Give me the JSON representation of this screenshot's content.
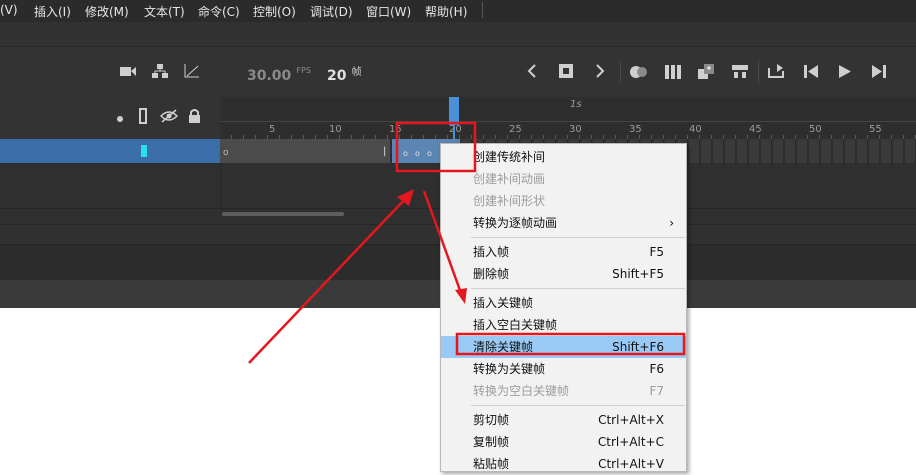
{
  "menubar": {
    "items": [
      "(V)",
      "插入(I)",
      "修改(M)",
      "文本(T)",
      "命令(C)",
      "控制(O)",
      "调试(D)",
      "窗口(W)",
      "帮助(H)"
    ]
  },
  "toolbar": {
    "fps_value": "30.00",
    "fps_unit": "FPS",
    "frame_value": "20",
    "frame_unit": "帧"
  },
  "ruler": {
    "second_label": "1s",
    "ticks": [
      "5",
      "10",
      "15",
      "20",
      "25",
      "30",
      "35",
      "40",
      "45",
      "50",
      "55"
    ]
  },
  "context_menu": {
    "items": [
      {
        "label": "创建传统补间",
        "shortcut": "",
        "disabled": false
      },
      {
        "label": "创建补间动画",
        "shortcut": "",
        "disabled": true
      },
      {
        "label": "创建补间形状",
        "shortcut": "",
        "disabled": true
      },
      {
        "label": "转换为逐帧动画",
        "shortcut": "›",
        "disabled": false
      },
      {
        "label": "插入帧",
        "shortcut": "F5",
        "disabled": false
      },
      {
        "label": "删除帧",
        "shortcut": "Shift+F5",
        "disabled": false
      },
      {
        "label": "插入关键帧",
        "shortcut": "",
        "disabled": false
      },
      {
        "label": "插入空白关键帧",
        "shortcut": "",
        "disabled": false
      },
      {
        "label": "清除关键帧",
        "shortcut": "Shift+F6",
        "disabled": false,
        "highlighted": true
      },
      {
        "label": "转换为关键帧",
        "shortcut": "F6",
        "disabled": false
      },
      {
        "label": "转换为空白关键帧",
        "shortcut": "F7",
        "disabled": true
      },
      {
        "label": "剪切帧",
        "shortcut": "Ctrl+Alt+X",
        "disabled": false
      },
      {
        "label": "复制帧",
        "shortcut": "Ctrl+Alt+C",
        "disabled": false
      },
      {
        "label": "粘贴帧",
        "shortcut": "Ctrl+Alt+V",
        "disabled": false
      }
    ]
  },
  "colors": {
    "highlight": "#99c9f5",
    "annotation": "#e5171e",
    "layer_selected": "#3b6ea8",
    "playhead": "#4a90d9"
  },
  "icons": [
    "camera-icon",
    "hierarchy-icon",
    "ease-graph-icon",
    "prev-frame-icon",
    "stop-icon",
    "next-frame-icon",
    "onion-skin-icon",
    "onion-outline-icon",
    "edit-multiple-icon",
    "center-frame-icon",
    "loop-icon",
    "step-back-icon",
    "play-icon",
    "step-forward-icon",
    "dot-icon",
    "outline-icon",
    "eye-icon",
    "lock-icon"
  ]
}
